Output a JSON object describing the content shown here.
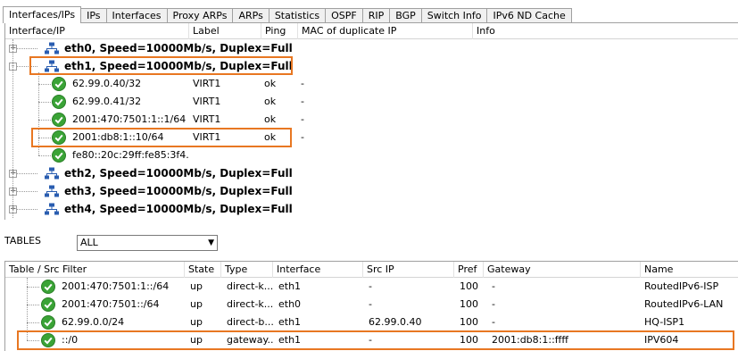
{
  "tabs": [
    "Interfaces/IPs",
    "IPs",
    "Interfaces",
    "Proxy ARPs",
    "ARPs",
    "Statistics",
    "OSPF",
    "RIP",
    "BGP",
    "Switch Info",
    "IPv6 ND Cache"
  ],
  "colors": {
    "highlight": "#e87722",
    "ok_green": "#3aa336",
    "net_icon_blue": "#2a5db0"
  },
  "top_grid": {
    "columns": [
      "Interface/IP",
      "Label",
      "Ping",
      "MAC of duplicate IP",
      "Info"
    ],
    "rows": [
      {
        "kind": "interface",
        "text": "eth0, Speed=10000Mb/s, Duplex=Full",
        "expander": "+"
      },
      {
        "kind": "interface",
        "text": "eth1, Speed=10000Mb/s, Duplex=Full",
        "expander": "-"
      },
      {
        "kind": "ip",
        "ip": "62.99.0.40/32",
        "label": "VIRT1",
        "ping": "ok",
        "mac": "-"
      },
      {
        "kind": "ip",
        "ip": "62.99.0.41/32",
        "label": "VIRT1",
        "ping": "ok",
        "mac": "-"
      },
      {
        "kind": "ip",
        "ip": "2001:470:7501:1::1/64",
        "label": "VIRT1",
        "ping": "ok",
        "mac": "-"
      },
      {
        "kind": "ip",
        "ip": "2001:db8:1::10/64",
        "label": "VIRT1",
        "ping": "ok",
        "mac": "-"
      },
      {
        "kind": "ip",
        "ip": "fe80::20c:29ff:fe85:3f4...",
        "label": "",
        "ping": "",
        "mac": ""
      },
      {
        "kind": "interface",
        "text": "eth2, Speed=10000Mb/s, Duplex=Full",
        "expander": "+"
      },
      {
        "kind": "interface",
        "text": "eth3, Speed=10000Mb/s, Duplex=Full",
        "expander": "+"
      },
      {
        "kind": "interface",
        "text": "eth4, Speed=10000Mb/s, Duplex=Full",
        "expander": "+"
      }
    ]
  },
  "tables": {
    "label": "TABLES",
    "selected": "ALL"
  },
  "bottom_grid": {
    "columns": [
      "Table / Src Filter",
      "State",
      "Type",
      "Interface",
      "Src IP",
      "Pref",
      "Gateway",
      "Name"
    ],
    "rows": [
      {
        "dest": "2001:470:7501:1::/64",
        "state": "up",
        "type": "direct-k...",
        "iface": "eth1",
        "src": "-",
        "pref": "100",
        "gw": "-",
        "name": "RoutedIPv6-ISP"
      },
      {
        "dest": "2001:470:7501::/64",
        "state": "up",
        "type": "direct-k...",
        "iface": "eth0",
        "src": "-",
        "pref": "100",
        "gw": "-",
        "name": "RoutedIPv6-LAN"
      },
      {
        "dest": "62.99.0.0/24",
        "state": "up",
        "type": "direct-b...",
        "iface": "eth1",
        "src": "62.99.0.40",
        "pref": "100",
        "gw": "-",
        "name": "HQ-ISP1"
      },
      {
        "dest": "::/0",
        "state": "up",
        "type": "gateway...",
        "iface": "eth1",
        "src": "-",
        "pref": "100",
        "gw": "2001:db8:1::ffff",
        "name": "IPV604"
      }
    ]
  }
}
